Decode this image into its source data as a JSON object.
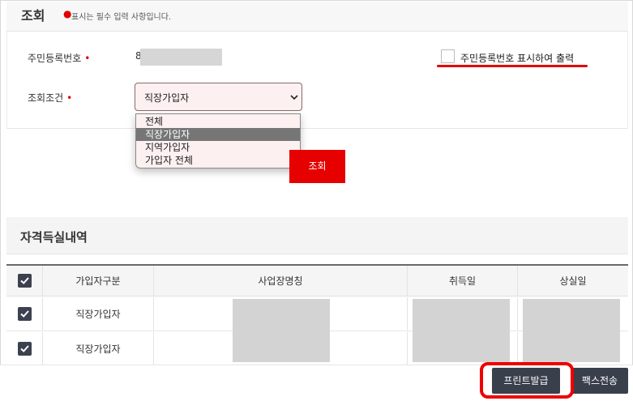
{
  "header": {
    "title": "조회",
    "required_note": "표시는 필수 입력 사항입니다."
  },
  "form": {
    "jumin_label": "주민등록번호",
    "jumin_value": "8",
    "show_jumin_label": "주민등록번호 표시하여 출력",
    "condition_label": "조회조건",
    "condition_selected": "직장가입자",
    "options": [
      "전체",
      "직장가입자",
      "지역가입자",
      "가입자 전체"
    ],
    "search_button": "조회"
  },
  "section": {
    "title": "자격득실내역"
  },
  "table": {
    "columns": [
      "가입자구분",
      "사업장명칭",
      "취득일",
      "상실일"
    ],
    "rows": [
      {
        "type": "직장가입자"
      },
      {
        "type": "직장가입자"
      }
    ]
  },
  "actions": {
    "print": "프린트발급",
    "fax": "팩스전송"
  },
  "colors": {
    "accent_red": "#e60000",
    "dark_button": "#3a3f4c"
  }
}
